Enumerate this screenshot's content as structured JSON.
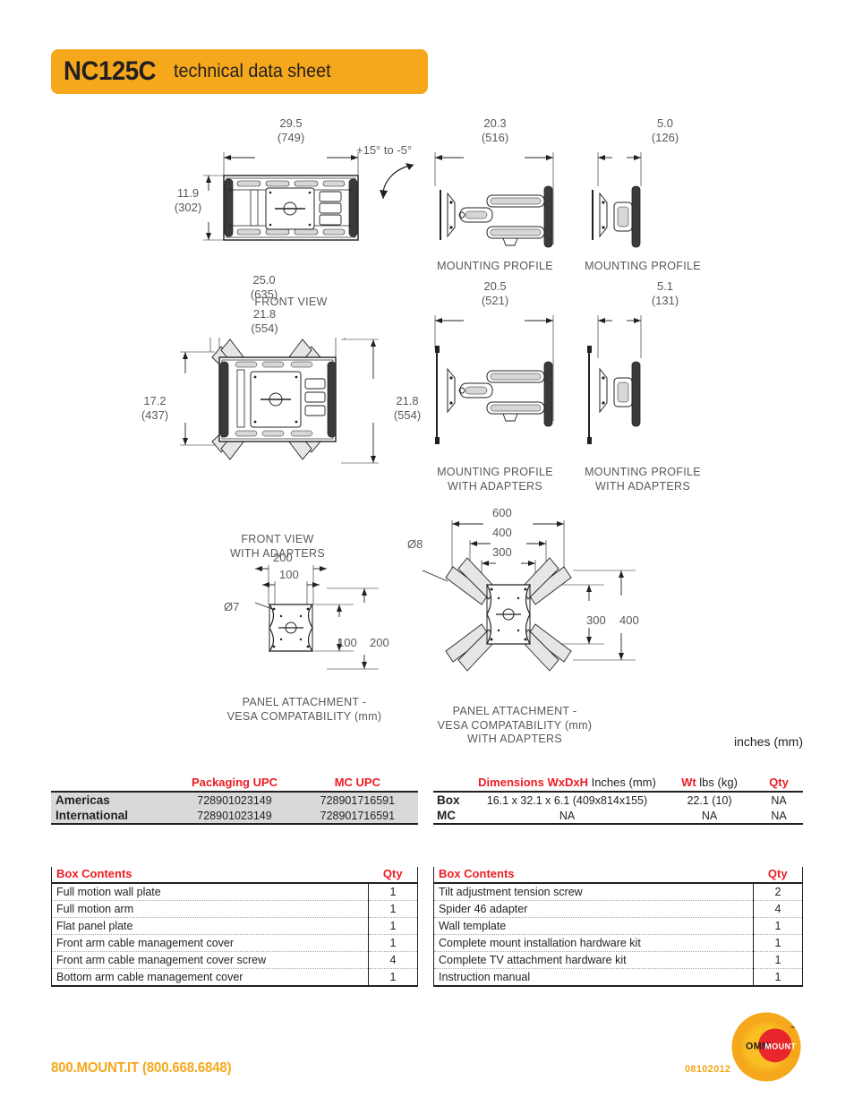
{
  "header": {
    "model": "NC125C",
    "subtitle": "technical data sheet"
  },
  "drawings": {
    "units_note": "inches (mm)",
    "tilt_note": "+15° to -5°",
    "views": [
      {
        "id": "front-view",
        "label": "FRONT VIEW",
        "width_in": "29.5",
        "width_mm": "(749)",
        "height_in": "11.9",
        "height_mm": "(302)"
      },
      {
        "id": "mounting-profile-extended",
        "label": "MOUNTING PROFILE",
        "depth_in": "20.3",
        "depth_mm": "(516)"
      },
      {
        "id": "mounting-profile-retracted",
        "label": "MOUNTING PROFILE",
        "depth_in": "5.0",
        "depth_mm": "(126)"
      },
      {
        "id": "front-view-adapters",
        "label_line1": "FRONT VIEW",
        "label_line2": "WITH ADAPTERS",
        "outer_width_in": "25.0",
        "outer_width_mm": "(635)",
        "inner_width_in": "21.8",
        "inner_width_mm": "(554)",
        "height_in": "17.2",
        "height_mm": "(437)",
        "right_height_in": "21.8",
        "right_height_mm": "(554)"
      },
      {
        "id": "mounting-profile-extended-adapters",
        "label_line1": "MOUNTING PROFILE",
        "label_line2": "WITH ADAPTERS",
        "depth_in": "20.5",
        "depth_mm": "(521)"
      },
      {
        "id": "mounting-profile-retracted-adapters",
        "label_line1": "MOUNTING PROFILE",
        "label_line2": "WITH ADAPTERS",
        "depth_in": "5.1",
        "depth_mm": "(131)"
      },
      {
        "id": "panel-attachment-vesa",
        "label_line1": "PANEL ATTACHMENT -",
        "label_line2": "VESA COMPATABILITY (mm)",
        "hole_callout": "Ø7",
        "horizontal_outer": "200",
        "horizontal_inner": "100",
        "vertical_inner": "100",
        "vertical_outer": "200"
      },
      {
        "id": "panel-attachment-vesa-adapters",
        "label_line1": "PANEL ATTACHMENT -",
        "label_line2": "VESA COMPATABILITY (mm)",
        "label_line3": "WITH ADAPTERS",
        "hole_callout": "Ø8",
        "horizontal_outer": "600",
        "horizontal_mid": "400",
        "horizontal_inner": "300",
        "vertical_inner": "300",
        "vertical_outer": "400"
      }
    ]
  },
  "upc_table": {
    "headers": [
      "",
      "Packaging UPC",
      "MC UPC"
    ],
    "rows": [
      {
        "region": "Americas",
        "packaging_upc": "728901023149",
        "mc_upc": "728901716591"
      },
      {
        "region": "International",
        "packaging_upc": "728901023149",
        "mc_upc": "728901716591"
      }
    ]
  },
  "dimensions_table": {
    "headers": {
      "spacer": "",
      "dimensions_bold": "Dimensions WxDxH",
      "dimensions_light": "Inches (mm)",
      "weight_bold": "Wt",
      "weight_light": "lbs (kg)",
      "qty": "Qty"
    },
    "rows": [
      {
        "label": "Box",
        "dimensions": "16.1 x 32.1 x 6.1 (409x814x155)",
        "weight": "22.1 (10)",
        "qty": "NA"
      },
      {
        "label": "MC",
        "dimensions": "NA",
        "weight": "NA",
        "qty": "NA"
      }
    ]
  },
  "box_contents_left": {
    "header_item": "Box Contents",
    "header_qty": "Qty",
    "rows": [
      {
        "item": "Full motion wall plate",
        "qty": "1"
      },
      {
        "item": "Full motion arm",
        "qty": "1"
      },
      {
        "item": "Flat panel plate",
        "qty": "1"
      },
      {
        "item": "Front arm cable management cover",
        "qty": "1"
      },
      {
        "item": "Front arm cable management cover screw",
        "qty": "4"
      },
      {
        "item": "Bottom arm cable management cover",
        "qty": "1"
      }
    ]
  },
  "box_contents_right": {
    "header_item": "Box Contents",
    "header_qty": "Qty",
    "rows": [
      {
        "item": "Tilt adjustment tension screw",
        "qty": "2"
      },
      {
        "item": "Spider 46 adapter",
        "qty": "4"
      },
      {
        "item": "Wall template",
        "qty": "1"
      },
      {
        "item": "Complete mount installation hardware kit",
        "qty": "1"
      },
      {
        "item": "Complete TV attachment hardware kit",
        "qty": "1"
      },
      {
        "item": "Instruction manual",
        "qty": "1"
      }
    ]
  },
  "footer": {
    "phone": "800.MOUNT.IT (800.668.6848)",
    "date_code": "08102012",
    "logo_omni": "OMNI",
    "logo_mount": "MOUNT",
    "logo_tm": "™"
  },
  "colors": {
    "brand_amber": "#F5A81C",
    "brand_red": "#ED1C24",
    "logo_red": "#E8262B",
    "table_gray": "#D9D9D9",
    "dim_gray": "#58595b"
  }
}
